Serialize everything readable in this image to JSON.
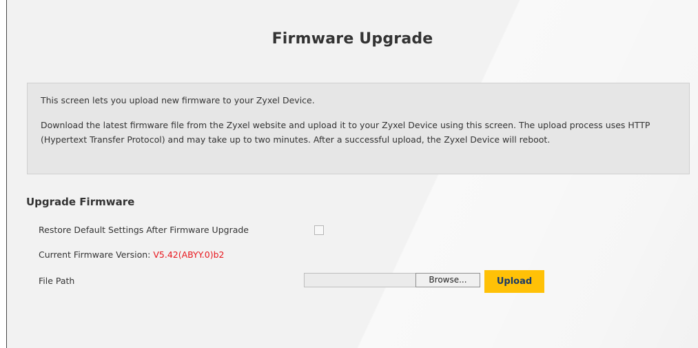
{
  "page": {
    "title": "Firmware Upgrade"
  },
  "info": {
    "line1": "This screen lets you upload new firmware to your Zyxel Device.",
    "line2": "Download the latest firmware file from the Zyxel website and upload it to your Zyxel Device using this screen. The upload process uses HTTP (Hypertext Transfer Protocol) and may take up to two minutes. After a successful upload, the Zyxel Device will reboot."
  },
  "upgrade": {
    "section_title": "Upgrade Firmware",
    "restore_label": "Restore Default Settings After Firmware Upgrade",
    "restore_checked": false,
    "version_label": "Current Firmware Version: ",
    "version_value": "V5.42(ABYY.0)b2",
    "file_path_label": "File Path",
    "file_path_value": "",
    "browse_label": "Browse...",
    "upload_label": "Upload"
  },
  "colors": {
    "accent": "#ffc107",
    "version": "#e8141b",
    "upload_text": "#1a3a66"
  }
}
